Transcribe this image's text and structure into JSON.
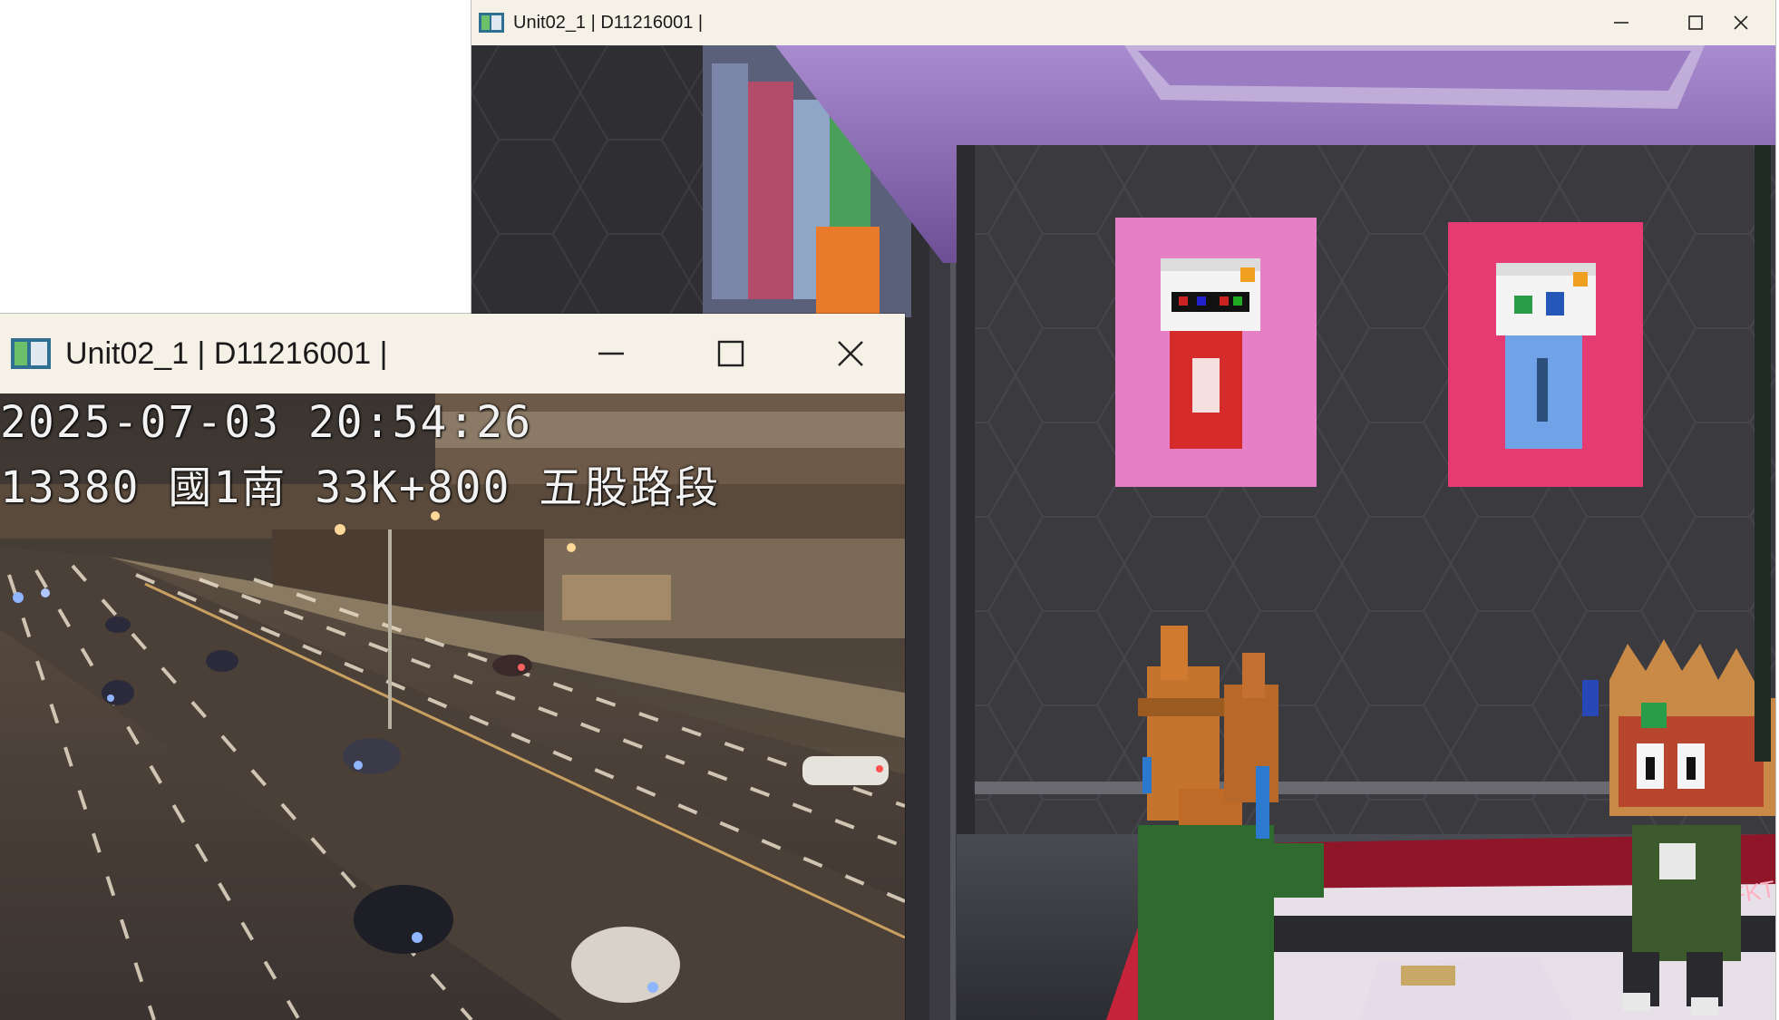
{
  "back_window": {
    "title": "Unit02_1 | D11216001 |",
    "controls": {
      "minimize": "minimize-icon",
      "maximize": "maximize-icon",
      "close": "close-icon"
    },
    "scene": {
      "booth_text": "TFKT"
    }
  },
  "front_window": {
    "title": "Unit02_1 | D11216001 |",
    "controls": {
      "minimize": "minimize-icon",
      "maximize": "maximize-icon",
      "close": "close-icon"
    },
    "camera": {
      "timestamp": "2025-07-03 20:54:26",
      "location": "13380 國1南 33K+800 五股路段"
    }
  },
  "colors": {
    "titlebar": "#f6f1e6",
    "poster_left": "#e77fc6",
    "poster_right": "#e43b72",
    "wall": "#3a3a3f",
    "ceiling": "#8a66b0",
    "sofa": "#c4233a"
  }
}
